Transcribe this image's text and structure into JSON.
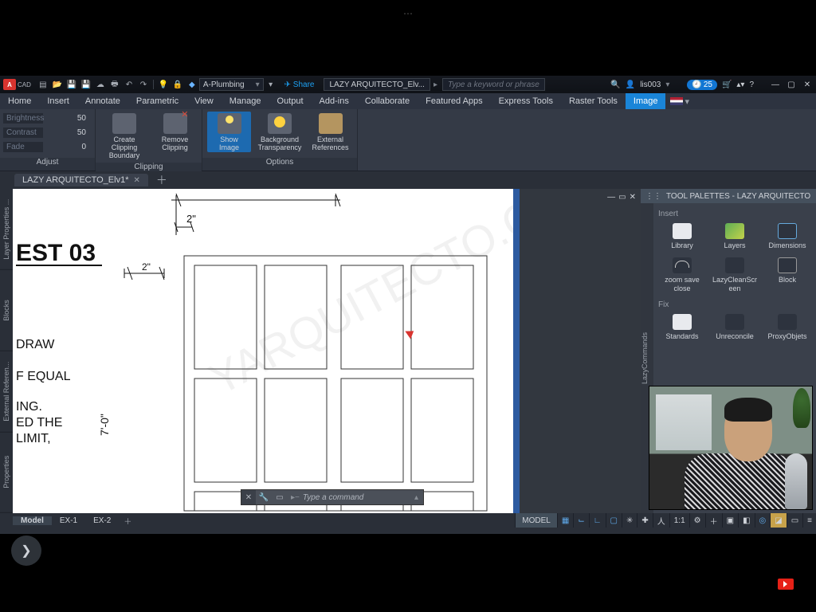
{
  "qat": {
    "logo": "A",
    "cad": "CAD",
    "layer": "A-Plumbing",
    "share": "Share",
    "file": "LAZY ARQUITECTO_Elv...",
    "search_placeholder": "Type a keyword or phrase",
    "user": "lis003",
    "timer": "25"
  },
  "menu": {
    "items": [
      "Home",
      "Insert",
      "Annotate",
      "Parametric",
      "View",
      "Manage",
      "Output",
      "Add-ins",
      "Collaborate",
      "Featured Apps",
      "Express Tools",
      "Raster Tools",
      "Image"
    ],
    "active": "Image"
  },
  "ribbon": {
    "adjust": {
      "label": "Adjust",
      "rows": [
        {
          "name": "Brightness",
          "value": "50"
        },
        {
          "name": "Contrast",
          "value": "50"
        },
        {
          "name": "Fade",
          "value": "0"
        }
      ]
    },
    "clipping": {
      "label": "Clipping",
      "btns": [
        {
          "name": "create-clipping-boundary",
          "l1": "Create Clipping",
          "l2": "Boundary"
        },
        {
          "name": "remove-clipping",
          "l1": "Remove",
          "l2": "Clipping"
        }
      ]
    },
    "options": {
      "label": "Options",
      "btns": [
        {
          "name": "show-image",
          "l1": "Show",
          "l2": "Image",
          "sel": true
        },
        {
          "name": "background-transparency",
          "l1": "Background",
          "l2": "Transparency"
        },
        {
          "name": "external-references",
          "l1": "External",
          "l2": "References"
        }
      ]
    }
  },
  "filetab": {
    "name": "LAZY ARQUITECTO_Elv1*"
  },
  "left_tabs": [
    "Layer Properties ...",
    "Blocks",
    "External Referen...",
    "Properties"
  ],
  "canvas": {
    "title": "EST 03",
    "dim1": "2\"",
    "dim2": "2\"",
    "height": "7'-0\"",
    "notes": [
      "DRAW",
      "F EQUAL",
      "ING.",
      "ED THE",
      " LIMIT,"
    ],
    "watermark": "LAZYARQUITECTO.CO"
  },
  "cmd": {
    "placeholder": "Type a command"
  },
  "palette": {
    "title": "TOOL PALETTES - LAZY ARQUITECTO",
    "vtab": "LazyCommands",
    "g1": "Insert",
    "g1_items": [
      {
        "n": "library",
        "l": "Library"
      },
      {
        "n": "layers",
        "l": "Layers"
      },
      {
        "n": "dimensions",
        "l": "Dimensions"
      }
    ],
    "g1b_items": [
      {
        "n": "zoom-save-close",
        "l": "zoom save close"
      },
      {
        "n": "lazy-clean-screen",
        "l": "LazyCleanScr een"
      },
      {
        "n": "block",
        "l": "Block"
      }
    ],
    "g2": "Fix",
    "g2_items": [
      {
        "n": "standards",
        "l": "Standards"
      },
      {
        "n": "unreconcile",
        "l": "Unreconcile"
      },
      {
        "n": "proxy-objects",
        "l": "ProxyObjets"
      }
    ]
  },
  "model_tabs": [
    "Model",
    "EX-1",
    "EX-2"
  ],
  "status": {
    "model": "MODEL",
    "scale": "1:1"
  }
}
